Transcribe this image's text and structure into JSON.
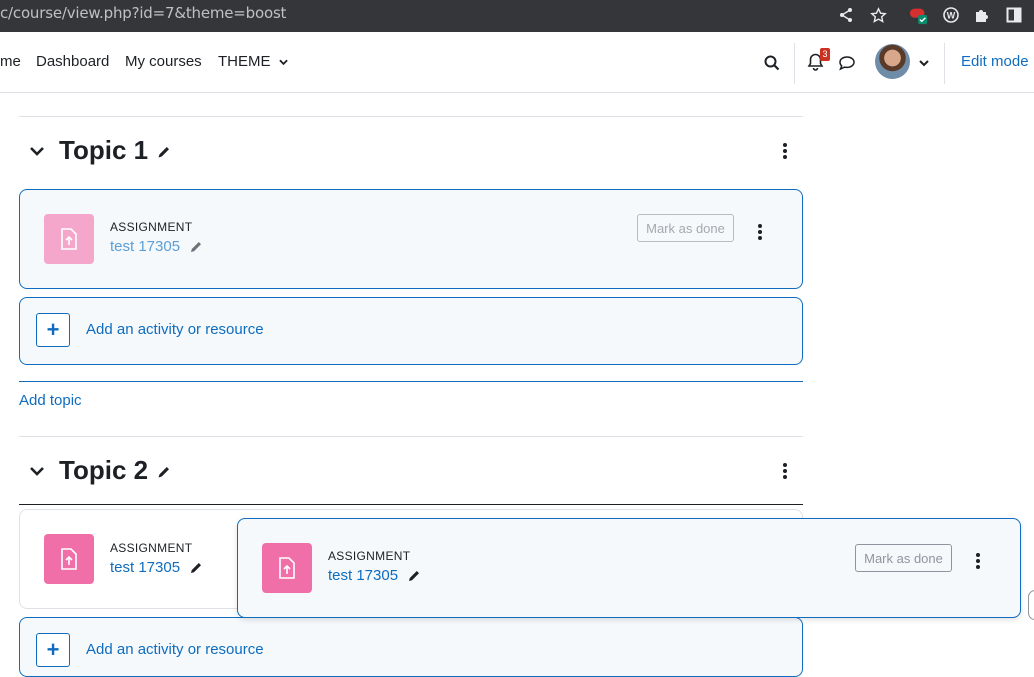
{
  "browser": {
    "url_text": "c/course/view.php?id=7&theme=boost",
    "icons": [
      "share-icon",
      "star-icon",
      "extension-lastpass-icon",
      "extension-w-icon",
      "puzzle-icon",
      "sidebar-icon"
    ]
  },
  "nav": {
    "home_label": "me",
    "dashboard_label": "Dashboard",
    "mycourses_label": "My courses",
    "theme_label": "THEME",
    "notification_count": "3",
    "edit_mode_label": "Edit mode"
  },
  "sections": [
    {
      "title": "Topic 1",
      "activity": {
        "type_label": "ASSIGNMENT",
        "name": "test 17305",
        "mark_done_label": "Mark as done"
      },
      "add_label": "Add an activity or resource"
    },
    {
      "title": "Topic 2",
      "activity": {
        "type_label": "ASSIGNMENT",
        "name": "test 17305"
      },
      "add_label": "Add an activity or resource"
    }
  ],
  "add_topic_label": "Add topic",
  "dragging": {
    "type_label": "ASSIGNMENT",
    "name": "test 17305",
    "mark_done_label": "Mark as done"
  },
  "colors": {
    "link": "#0f6cbf",
    "assignment_icon": "#f16fa9",
    "badge": "#ca3120"
  }
}
